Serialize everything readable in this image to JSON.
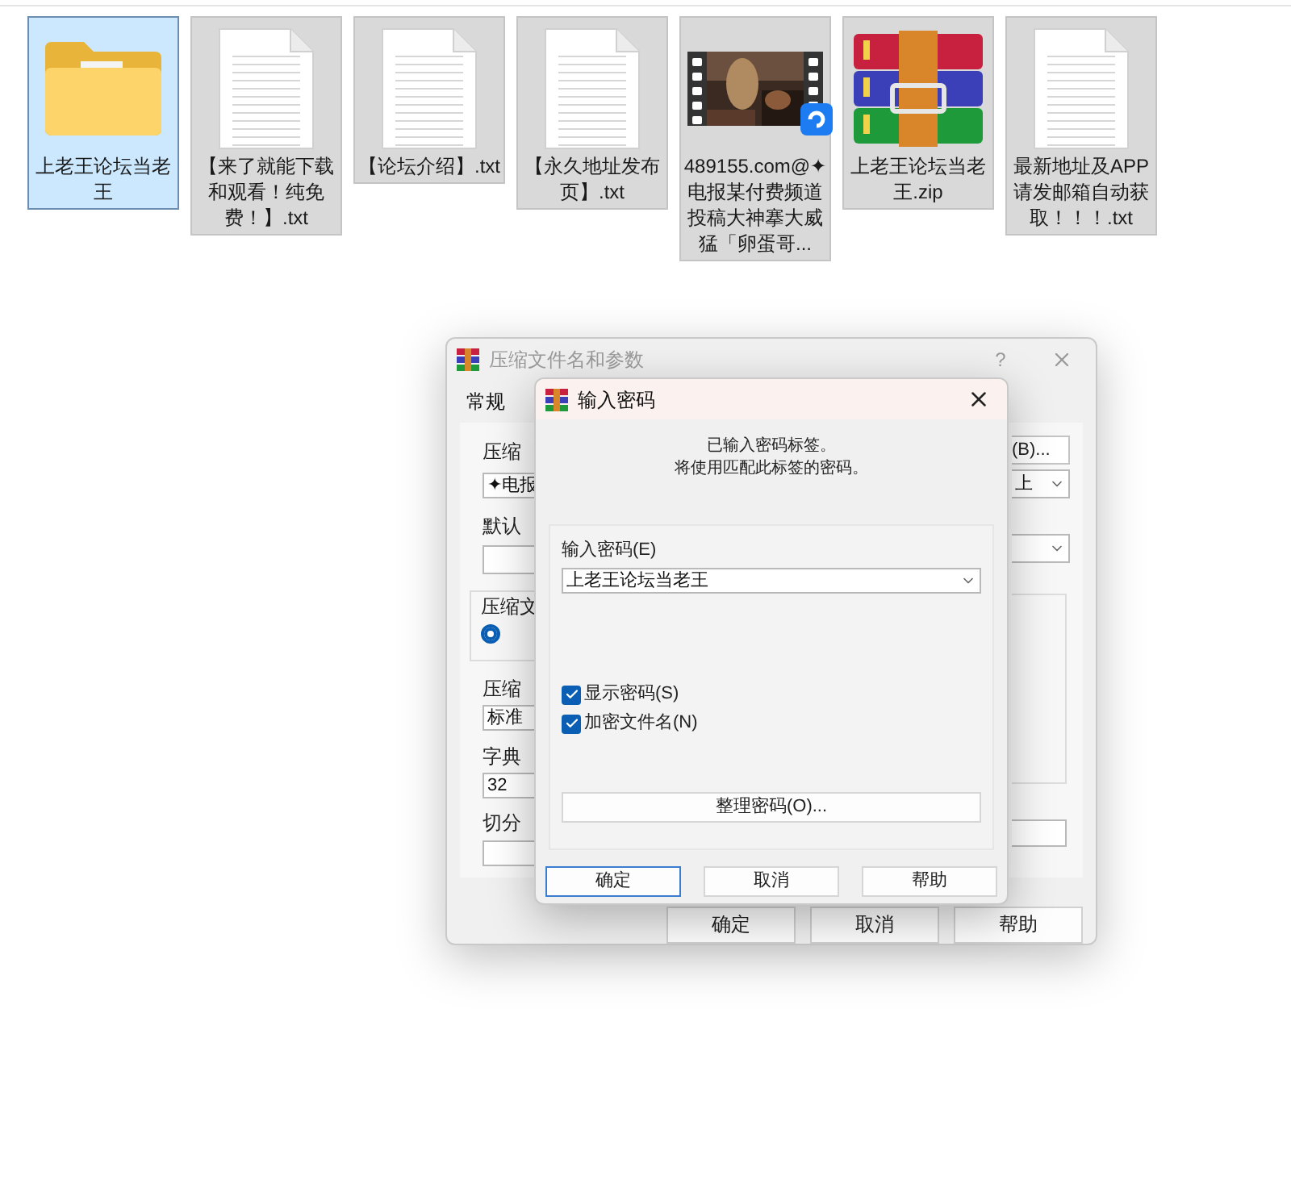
{
  "desktop_items": [
    {
      "label": "上老王论坛当老王",
      "kind": "folder",
      "selected": true,
      "focused": true
    },
    {
      "label": "【来了就能下载和观看！纯免费！】.txt",
      "kind": "text",
      "selected": true,
      "focused": false
    },
    {
      "label": "【论坛介绍】.txt",
      "kind": "text",
      "selected": true,
      "focused": false
    },
    {
      "label": "【永久地址发布页】.txt",
      "kind": "text",
      "selected": true,
      "focused": false
    },
    {
      "label": "489155.com@✦电报某付费频道投稿大神搴大威猛「卵蛋哥...",
      "kind": "video",
      "selected": true,
      "focused": false
    },
    {
      "label": "上老王论坛当老王.zip",
      "kind": "archive",
      "selected": true,
      "focused": false
    },
    {
      "label": "最新地址及APP请发邮箱自动获取！！！.txt",
      "kind": "text",
      "selected": true,
      "focused": false
    }
  ],
  "back_window": {
    "title": "压缩文件名和参数",
    "help_button": "?",
    "tabs": [
      {
        "label": "常规",
        "selected": true
      }
    ],
    "archive_name_label": "压缩",
    "archive_name_value": "✦电报",
    "browse_button": "(B)...",
    "update_mode_value": "上",
    "profile_label": "默认",
    "format_group_label": "压缩文",
    "format_radio_selected": true,
    "method_label": "压缩",
    "method_value": "标准",
    "dictionary_label": "字典",
    "dictionary_value": "32",
    "split_label": "切分",
    "buttons": [
      "确定",
      "取消",
      "帮助"
    ]
  },
  "password_dialog": {
    "title": "输入密码",
    "message": [
      "已输入密码标签。",
      "将使用匹配此标签的密码。"
    ],
    "password_label": "输入密码(E)",
    "password_value": "上老王论坛当老王",
    "checkboxes": [
      {
        "label": "显示密码(S)",
        "checked": true
      },
      {
        "label": "加密文件名(N)",
        "checked": true
      }
    ],
    "organize_button": "整理密码(O)...",
    "buttons": [
      {
        "label": "确定",
        "default": true
      },
      {
        "label": "取消",
        "default": false
      },
      {
        "label": "帮助",
        "default": false
      }
    ]
  }
}
